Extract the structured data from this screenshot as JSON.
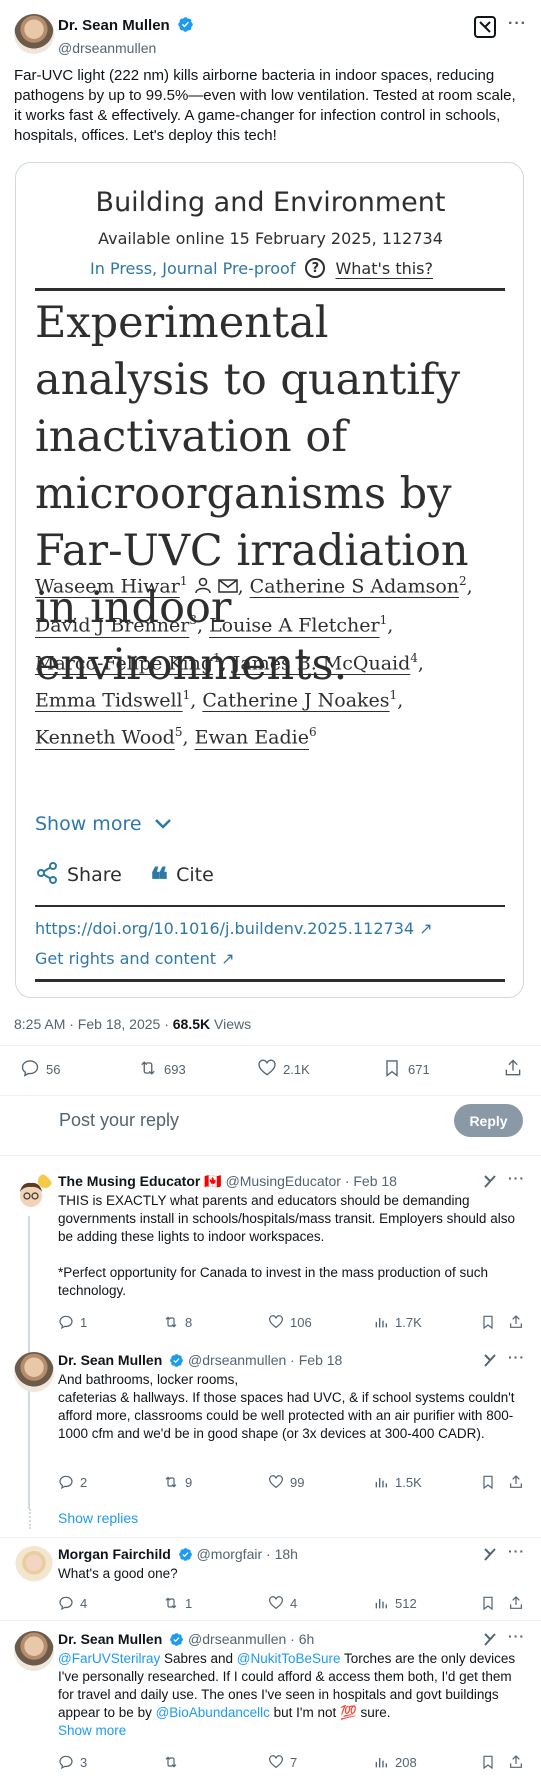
{
  "post": {
    "author_name": "Dr. Sean Mullen",
    "author_handle": "@drseanmullen",
    "text": "Far-UVC light (222 nm) kills airborne bacteria in indoor spaces, reducing pathogens by up to 99.5%—even with low ventilation. Tested at room scale, it works fast & effectively. A game-changer for infection control in schools, hospitals, offices. Let's deploy this tech!",
    "timestamp": "8:25 AM · Feb 18, 2025 · ",
    "views_count": "68.5K",
    "views_label": " Views",
    "stats": {
      "replies": "56",
      "reposts": "693",
      "likes": "2.1K",
      "bookmarks": "671"
    }
  },
  "paper": {
    "journal": "Building and Environment",
    "available": "Available online 15 February 2025, 112734",
    "status": "In Press, Journal Pre-proof",
    "whats_this": "What's this?",
    "title": "Experimental analysis to quantify inactivation of microorganisms by Far-UVC irradiation in indoor environments.",
    "authors": {
      "a1": "Waseem Hiwar",
      "a1s": "1",
      "a2": "Catherine S Adamson",
      "a2s": "2",
      "a3": "David J Brenner",
      "a3s": "3",
      "a4": "Louise A Fletcher",
      "a4s": "1",
      "a5": "Marco-Felipe King",
      "a5s": "1",
      "a6": "James B. McQuaid",
      "a6s": "4",
      "a7": "Emma Tidswell",
      "a7s": "1",
      "a8": "Catherine J Noakes",
      "a8s": "1",
      "a9": "Kenneth Wood",
      "a9s": "5",
      "a10": "Ewan Eadie",
      "a10s": "6"
    },
    "show_more": "Show more",
    "share": "Share",
    "cite": "Cite",
    "doi": "https://doi.org/10.1016/j.buildenv.2025.112734",
    "rights": "Get rights and content"
  },
  "composer": {
    "placeholder": "Post your reply",
    "button": "Reply"
  },
  "replies": [
    {
      "name": "The Musing Educator 🇨🇦",
      "handle": "@MusingEducator · Feb 18",
      "text1": "THIS is EXACTLY what parents and educators should be demanding governments install in schools/hospitals/mass transit. Employers should also be adding these lights to indoor workspaces.",
      "text2": "*Perfect opportunity for Canada to invest in the mass production of such technology.",
      "stats": {
        "replies": "1",
        "reposts": "8",
        "likes": "106",
        "views": "1.7K"
      }
    },
    {
      "name": "Dr. Sean Mullen",
      "handle": "@drseanmullen · Feb 18",
      "text1": "And bathrooms, locker rooms,",
      "text2": "cafeterias & hallways. If those spaces had UVC, & if school systems couldn't afford more, classrooms could be well protected with an air purifier with 800-1000 cfm and we'd be in good shape (or 3x devices at 300-400 CADR).",
      "stats": {
        "replies": "2",
        "reposts": "9",
        "likes": "99",
        "views": "1.5K"
      },
      "show_replies": "Show replies"
    },
    {
      "name": "Morgan Fairchild",
      "handle": "@morgfair · 18h",
      "text1": "What's a good one?",
      "stats": {
        "replies": "4",
        "reposts": "1",
        "likes": "4",
        "views": "512"
      }
    },
    {
      "name": "Dr. Sean Mullen",
      "handle": "@drseanmullen · 6h",
      "mention1": "@FarUVSterilray",
      "t_a": " Sabres and ",
      "mention2": "@NukitToBeSure",
      "t_b": " Torches are the only devices I've personally researched. If I could afford & access them both, I'd get them for travel and daily use. The ones I've seen in hospitals and govt buildings appear to be by ",
      "mention3": "@BioAbundancellc",
      "t_c": " but I'm not 💯 sure.",
      "show_more": "Show more",
      "stats": {
        "replies": "3",
        "reposts": "",
        "likes": "7",
        "views": "208"
      }
    }
  ],
  "colors": {
    "accent": "#1d9bf0",
    "verified": "#1d9bf0",
    "text": "#0f1419",
    "muted": "#536471",
    "journal_link": "#2e78a8"
  }
}
